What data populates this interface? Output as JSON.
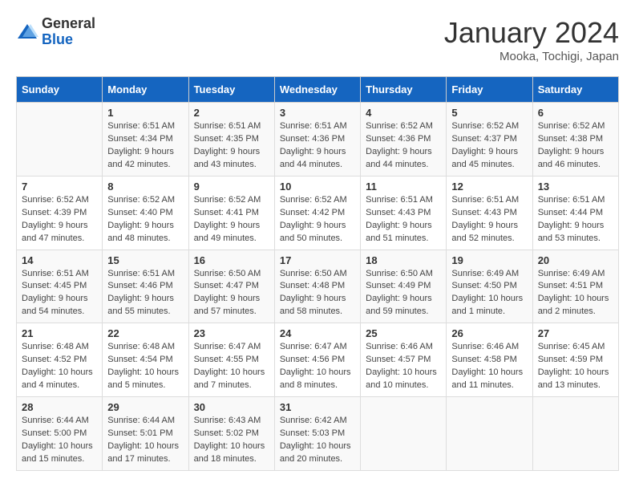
{
  "header": {
    "logo_general": "General",
    "logo_blue": "Blue",
    "month": "January 2024",
    "location": "Mooka, Tochigi, Japan"
  },
  "days_of_week": [
    "Sunday",
    "Monday",
    "Tuesday",
    "Wednesday",
    "Thursday",
    "Friday",
    "Saturday"
  ],
  "weeks": [
    [
      {
        "day": "",
        "sunrise": "",
        "sunset": "",
        "daylight": ""
      },
      {
        "day": "1",
        "sunrise": "Sunrise: 6:51 AM",
        "sunset": "Sunset: 4:34 PM",
        "daylight": "Daylight: 9 hours and 42 minutes."
      },
      {
        "day": "2",
        "sunrise": "Sunrise: 6:51 AM",
        "sunset": "Sunset: 4:35 PM",
        "daylight": "Daylight: 9 hours and 43 minutes."
      },
      {
        "day": "3",
        "sunrise": "Sunrise: 6:51 AM",
        "sunset": "Sunset: 4:36 PM",
        "daylight": "Daylight: 9 hours and 44 minutes."
      },
      {
        "day": "4",
        "sunrise": "Sunrise: 6:52 AM",
        "sunset": "Sunset: 4:36 PM",
        "daylight": "Daylight: 9 hours and 44 minutes."
      },
      {
        "day": "5",
        "sunrise": "Sunrise: 6:52 AM",
        "sunset": "Sunset: 4:37 PM",
        "daylight": "Daylight: 9 hours and 45 minutes."
      },
      {
        "day": "6",
        "sunrise": "Sunrise: 6:52 AM",
        "sunset": "Sunset: 4:38 PM",
        "daylight": "Daylight: 9 hours and 46 minutes."
      }
    ],
    [
      {
        "day": "7",
        "sunrise": "Sunrise: 6:52 AM",
        "sunset": "Sunset: 4:39 PM",
        "daylight": "Daylight: 9 hours and 47 minutes."
      },
      {
        "day": "8",
        "sunrise": "Sunrise: 6:52 AM",
        "sunset": "Sunset: 4:40 PM",
        "daylight": "Daylight: 9 hours and 48 minutes."
      },
      {
        "day": "9",
        "sunrise": "Sunrise: 6:52 AM",
        "sunset": "Sunset: 4:41 PM",
        "daylight": "Daylight: 9 hours and 49 minutes."
      },
      {
        "day": "10",
        "sunrise": "Sunrise: 6:52 AM",
        "sunset": "Sunset: 4:42 PM",
        "daylight": "Daylight: 9 hours and 50 minutes."
      },
      {
        "day": "11",
        "sunrise": "Sunrise: 6:51 AM",
        "sunset": "Sunset: 4:43 PM",
        "daylight": "Daylight: 9 hours and 51 minutes."
      },
      {
        "day": "12",
        "sunrise": "Sunrise: 6:51 AM",
        "sunset": "Sunset: 4:43 PM",
        "daylight": "Daylight: 9 hours and 52 minutes."
      },
      {
        "day": "13",
        "sunrise": "Sunrise: 6:51 AM",
        "sunset": "Sunset: 4:44 PM",
        "daylight": "Daylight: 9 hours and 53 minutes."
      }
    ],
    [
      {
        "day": "14",
        "sunrise": "Sunrise: 6:51 AM",
        "sunset": "Sunset: 4:45 PM",
        "daylight": "Daylight: 9 hours and 54 minutes."
      },
      {
        "day": "15",
        "sunrise": "Sunrise: 6:51 AM",
        "sunset": "Sunset: 4:46 PM",
        "daylight": "Daylight: 9 hours and 55 minutes."
      },
      {
        "day": "16",
        "sunrise": "Sunrise: 6:50 AM",
        "sunset": "Sunset: 4:47 PM",
        "daylight": "Daylight: 9 hours and 57 minutes."
      },
      {
        "day": "17",
        "sunrise": "Sunrise: 6:50 AM",
        "sunset": "Sunset: 4:48 PM",
        "daylight": "Daylight: 9 hours and 58 minutes."
      },
      {
        "day": "18",
        "sunrise": "Sunrise: 6:50 AM",
        "sunset": "Sunset: 4:49 PM",
        "daylight": "Daylight: 9 hours and 59 minutes."
      },
      {
        "day": "19",
        "sunrise": "Sunrise: 6:49 AM",
        "sunset": "Sunset: 4:50 PM",
        "daylight": "Daylight: 10 hours and 1 minute."
      },
      {
        "day": "20",
        "sunrise": "Sunrise: 6:49 AM",
        "sunset": "Sunset: 4:51 PM",
        "daylight": "Daylight: 10 hours and 2 minutes."
      }
    ],
    [
      {
        "day": "21",
        "sunrise": "Sunrise: 6:48 AM",
        "sunset": "Sunset: 4:52 PM",
        "daylight": "Daylight: 10 hours and 4 minutes."
      },
      {
        "day": "22",
        "sunrise": "Sunrise: 6:48 AM",
        "sunset": "Sunset: 4:54 PM",
        "daylight": "Daylight: 10 hours and 5 minutes."
      },
      {
        "day": "23",
        "sunrise": "Sunrise: 6:47 AM",
        "sunset": "Sunset: 4:55 PM",
        "daylight": "Daylight: 10 hours and 7 minutes."
      },
      {
        "day": "24",
        "sunrise": "Sunrise: 6:47 AM",
        "sunset": "Sunset: 4:56 PM",
        "daylight": "Daylight: 10 hours and 8 minutes."
      },
      {
        "day": "25",
        "sunrise": "Sunrise: 6:46 AM",
        "sunset": "Sunset: 4:57 PM",
        "daylight": "Daylight: 10 hours and 10 minutes."
      },
      {
        "day": "26",
        "sunrise": "Sunrise: 6:46 AM",
        "sunset": "Sunset: 4:58 PM",
        "daylight": "Daylight: 10 hours and 11 minutes."
      },
      {
        "day": "27",
        "sunrise": "Sunrise: 6:45 AM",
        "sunset": "Sunset: 4:59 PM",
        "daylight": "Daylight: 10 hours and 13 minutes."
      }
    ],
    [
      {
        "day": "28",
        "sunrise": "Sunrise: 6:44 AM",
        "sunset": "Sunset: 5:00 PM",
        "daylight": "Daylight: 10 hours and 15 minutes."
      },
      {
        "day": "29",
        "sunrise": "Sunrise: 6:44 AM",
        "sunset": "Sunset: 5:01 PM",
        "daylight": "Daylight: 10 hours and 17 minutes."
      },
      {
        "day": "30",
        "sunrise": "Sunrise: 6:43 AM",
        "sunset": "Sunset: 5:02 PM",
        "daylight": "Daylight: 10 hours and 18 minutes."
      },
      {
        "day": "31",
        "sunrise": "Sunrise: 6:42 AM",
        "sunset": "Sunset: 5:03 PM",
        "daylight": "Daylight: 10 hours and 20 minutes."
      },
      {
        "day": "",
        "sunrise": "",
        "sunset": "",
        "daylight": ""
      },
      {
        "day": "",
        "sunrise": "",
        "sunset": "",
        "daylight": ""
      },
      {
        "day": "",
        "sunrise": "",
        "sunset": "",
        "daylight": ""
      }
    ]
  ]
}
